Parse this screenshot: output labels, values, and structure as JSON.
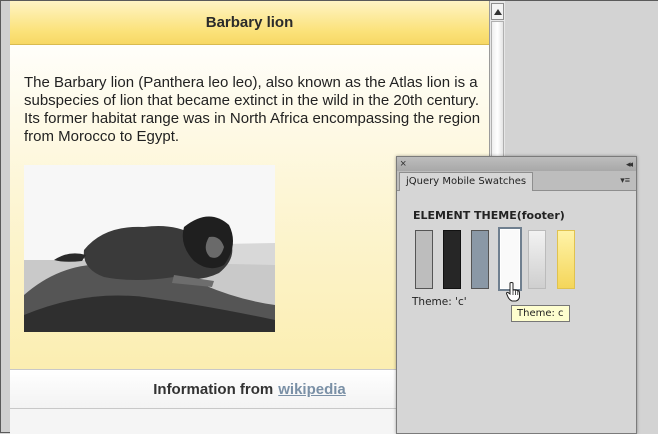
{
  "page": {
    "header_title": "Barbary lion",
    "body_text": "The Barbary lion (Panthera leo leo), also known as the Atlas lion is a subspecies of lion that became extinct in the wild in the 20th century. Its former habitat range was in North Africa encompassing the region from Morocco to Egypt.",
    "footer_text": "Information from",
    "footer_link": "wikipedia"
  },
  "panel": {
    "close_glyph": "×",
    "collapse_glyph": "◂◂",
    "menu_glyph": "▾≡",
    "tab_label": "jQuery Mobile Swatches",
    "heading": "ELEMENT THEME(footer)",
    "swatches": [
      "a",
      "b",
      "c",
      "d",
      "e",
      "f"
    ],
    "selected_theme_label": "Theme:  'c'",
    "tooltip": "Theme: c"
  },
  "colors": {
    "header_yellow": "#fbe27a",
    "link": "#7a90a6",
    "tooltip_bg": "#fefecf"
  }
}
